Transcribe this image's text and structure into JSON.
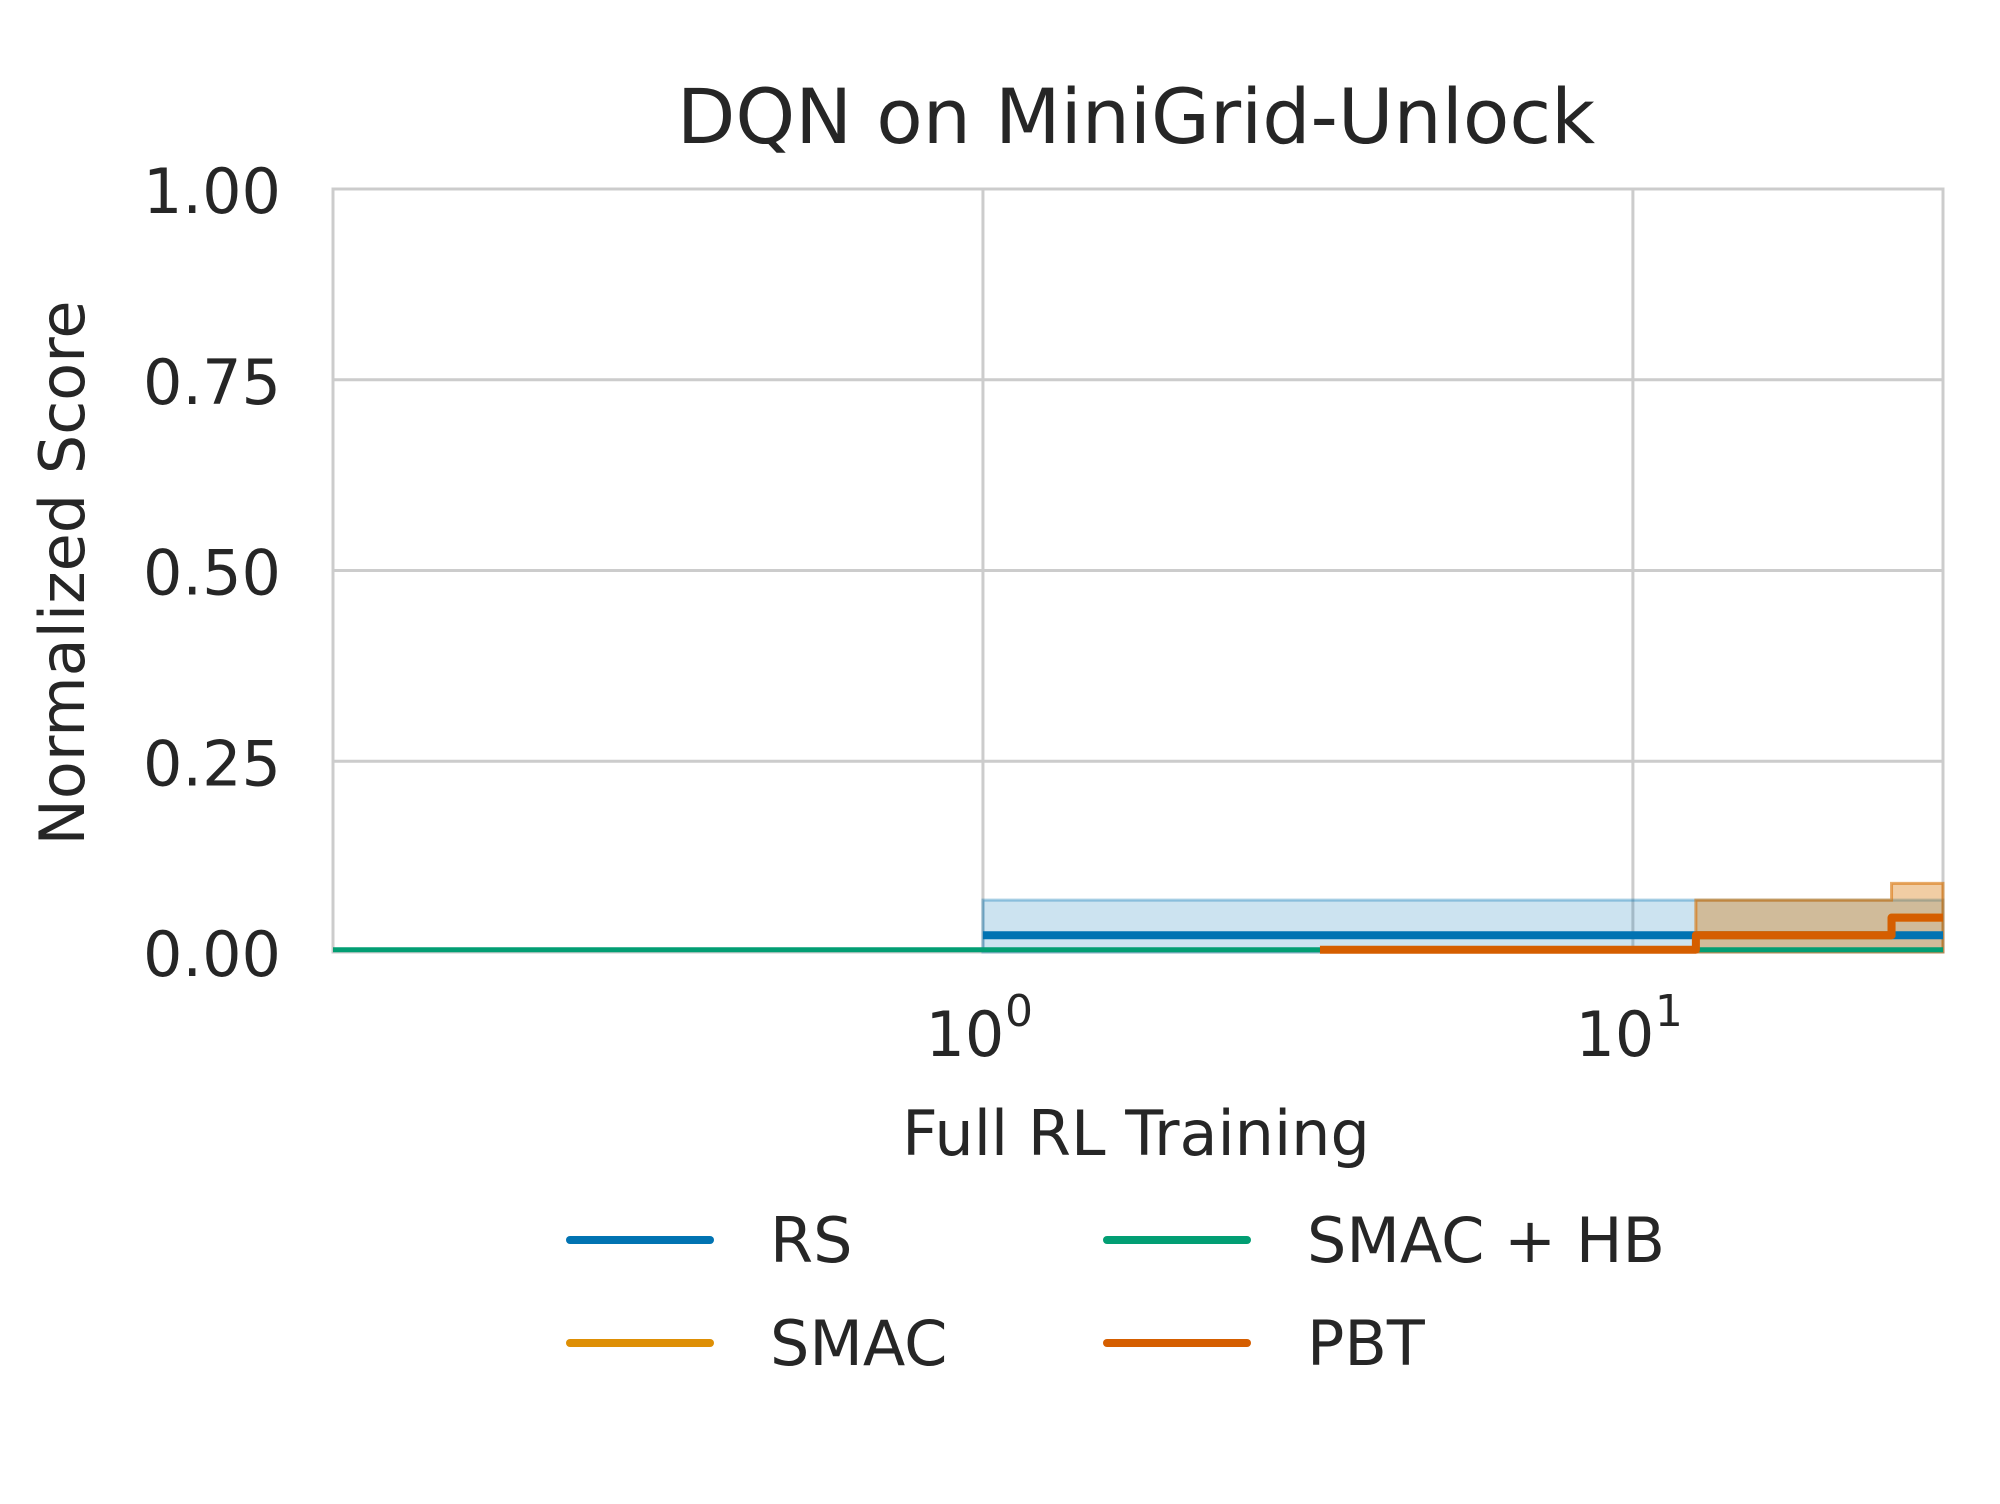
{
  "chart_data": {
    "type": "line",
    "title": "DQN on MiniGrid-Unlock",
    "xlabel": "Full RL Training",
    "ylabel": "Normalized Score",
    "x_scale": "log",
    "xlim": [
      0.1,
      30
    ],
    "ylim": [
      0,
      1
    ],
    "x_ticks": [
      {
        "value": 1,
        "base": "10",
        "exp": "0"
      },
      {
        "value": 10,
        "base": "10",
        "exp": "1"
      }
    ],
    "y_ticks": [
      {
        "value": 0,
        "label": "0.00"
      },
      {
        "value": 0.25,
        "label": "0.25"
      },
      {
        "value": 0.5,
        "label": "0.50"
      },
      {
        "value": 0.75,
        "label": "0.75"
      },
      {
        "value": 1,
        "label": "1.00"
      }
    ],
    "grid": true,
    "legend_position": "bottom-center",
    "series": [
      {
        "name": "RS",
        "color": "#0173b2",
        "x": [
          1,
          30
        ],
        "y": [
          0.022,
          0.022
        ],
        "y_lower": [
          0.0,
          0.0
        ],
        "y_upper": [
          0.068,
          0.068
        ]
      },
      {
        "name": "SMAC",
        "color": "#de8f05",
        "x": [
          12.5,
          25,
          30
        ],
        "y": [
          0.022,
          0.045,
          0.045
        ],
        "y_lower": [
          0.0,
          0.0,
          0.0
        ],
        "y_upper": [
          0.068,
          0.09,
          0.09
        ]
      },
      {
        "name": "SMAC + HB",
        "color": "#029e73",
        "x": [
          0.1,
          30
        ],
        "y": [
          0.003,
          0.003
        ],
        "y_lower": [
          0.0,
          0.0
        ],
        "y_upper": [
          0.0,
          0.0
        ]
      },
      {
        "name": "PBT",
        "color": "#d55e00",
        "x": [
          3.3,
          12.5,
          25,
          30
        ],
        "y": [
          0.003,
          0.022,
          0.045,
          0.045
        ],
        "y_lower": [
          0.0,
          0.0,
          0.0,
          0.0
        ],
        "y_upper": [
          0.0,
          0.068,
          0.09,
          0.09
        ]
      }
    ]
  }
}
